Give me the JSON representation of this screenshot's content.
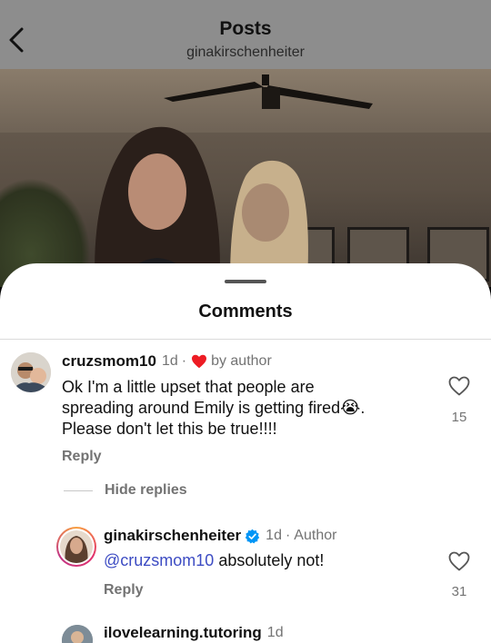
{
  "header": {
    "title": "Posts",
    "subtitle": "ginakirschenheiter"
  },
  "comments_sheet": {
    "title": "Comments",
    "comments": [
      {
        "username": "cruzsmom10",
        "time": "1d",
        "separator": "·",
        "liked_by_label": "by author",
        "text_line1": "Ok I'm a little upset that people are",
        "text_line2": "spreading around Emily is getting fired",
        "emoji": "😭",
        "text_line2_end": ".",
        "text_line3": "Please don't let this be true!!!!",
        "reply_label": "Reply",
        "likes": "15",
        "hide_replies_label": "Hide replies"
      },
      {
        "username": "ginakirschenheiter",
        "verified": true,
        "time": "1d",
        "separator": "·",
        "author_label": "Author",
        "mention": "@cruzsmom10",
        "text": " absolutely not!",
        "reply_label": "Reply",
        "likes": "31"
      },
      {
        "username": "ilovelearning.tutoring",
        "time": "1d"
      }
    ]
  },
  "colors": {
    "verified_blue": "#0095f6",
    "heart_red": "#ed1c24",
    "mention_blue": "#3d4cc3",
    "story_ring_gradient": [
      "#f9a03f",
      "#e1306c",
      "#c13584"
    ]
  }
}
